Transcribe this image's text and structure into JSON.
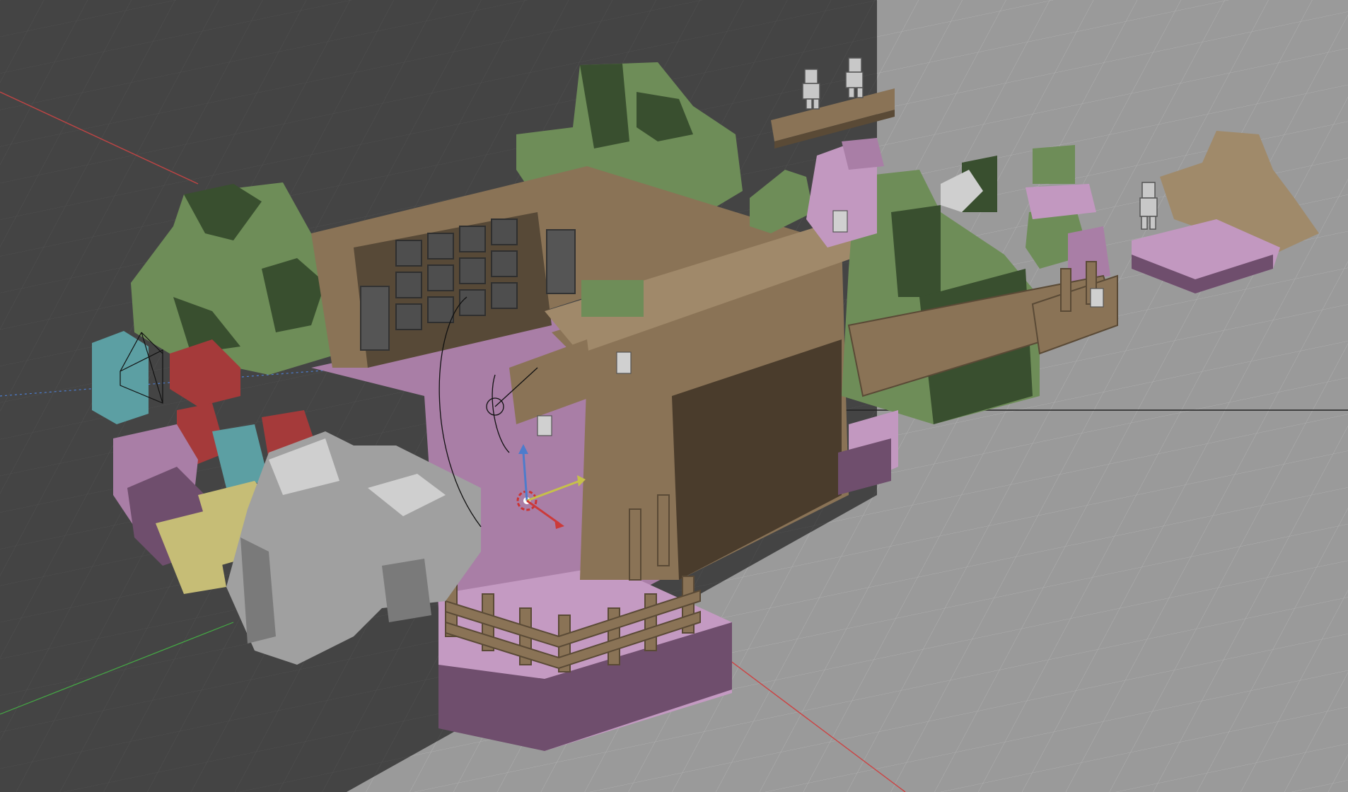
{
  "app": {
    "window_type": "3d-viewport",
    "view": "perspective",
    "shading": "solid"
  },
  "scene": {
    "objects": [
      "voxel-ground-platform",
      "wooden-house",
      "wooden-fence",
      "voxel-tree",
      "blocky-character",
      "light-lamp",
      "colored-blocks",
      "camera",
      "grey-rock",
      "small-island"
    ],
    "selected_object_origin": "3d-cursor"
  },
  "colors": {
    "viewport_dark": "#444444",
    "viewport_light": "#9a9a9a",
    "wood": "#8a7356",
    "wood_dark": "#574937",
    "grass": "#6e8d58",
    "grass_dark": "#394f2f",
    "pink": "#c298c0",
    "pink_dark": "#6f4e6d",
    "teal": "#5c9fa3",
    "red": "#a53a3a",
    "yellow": "#c6bd76",
    "stone": "#b8b8b8",
    "axis_x": "#cc4444",
    "axis_y": "#55aa55",
    "axis_z": "#4477cc"
  },
  "gizmo": {
    "icons": [
      "cursor-icon",
      "move-gizmo-icon",
      "light-gizmo-icon",
      "camera-icon"
    ]
  }
}
